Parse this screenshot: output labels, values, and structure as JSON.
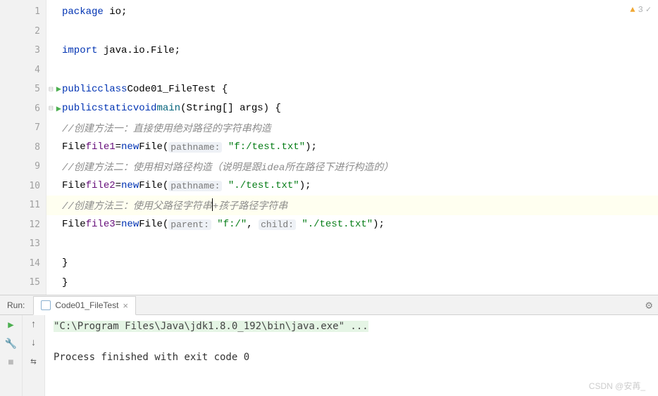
{
  "warnings": {
    "count": "3"
  },
  "gutter": [
    "1",
    "2",
    "3",
    "4",
    "5",
    "6",
    "7",
    "8",
    "9",
    "10",
    "11",
    "12",
    "13",
    "14",
    "15"
  ],
  "code": {
    "l1": {
      "kw": "package",
      "rest": " io;"
    },
    "l3": {
      "kw": "import",
      "rest": " java.io.File;"
    },
    "l5": {
      "kw1": "public",
      "kw2": "class",
      "cls": "Code01_FileTest",
      "brace": " {"
    },
    "l6": {
      "kw1": "public",
      "kw2": "static",
      "kw3": "void",
      "fn": "main",
      "args": "(String[] args) {"
    },
    "l7": {
      "cmt": "//创建方法一：直接使用绝对路径的字符串构造"
    },
    "l8": {
      "cls": "File",
      "var": "file1",
      "eq": "=",
      "kw": "new",
      "cls2": "File",
      "open": "(",
      "hint": "pathname:",
      "sp": " ",
      "str": "\"f:/test.txt\"",
      "close": ");"
    },
    "l9": {
      "cmt": "//创建方法二：使用相对路径构造（说明是跟idea所在路径下进行构造的）"
    },
    "l10": {
      "cls": "File",
      "var": "file2",
      "eq": "=",
      "kw": "new",
      "cls2": "File",
      "open": "(",
      "hint": "pathname:",
      "sp": " ",
      "str": "\"./test.txt\"",
      "close": ");"
    },
    "l11": {
      "cmt_a": "//创建方法三：使用父路径字符串",
      "cmt_b": "+孩子路径字符串"
    },
    "l12": {
      "cls": "File",
      "var": "file3",
      "eq": "=",
      "kw": "new",
      "cls2": "File",
      "open": "(",
      "hint1": "parent:",
      "sp1": " ",
      "str1": "\"f:/\"",
      "comma": ", ",
      "hint2": "child:",
      "sp2": " ",
      "str2": "\"./test.txt\"",
      "close": ");"
    },
    "l14": {
      "brace": "}"
    },
    "l15": {
      "brace": "}"
    }
  },
  "run": {
    "label": "Run:",
    "tab": "Code01_FileTest",
    "cmd": "\"C:\\Program Files\\Java\\jdk1.8.0_192\\bin\\java.exe\" ...",
    "exit": "Process finished with exit code 0"
  },
  "watermark": "CSDN @安苒_"
}
